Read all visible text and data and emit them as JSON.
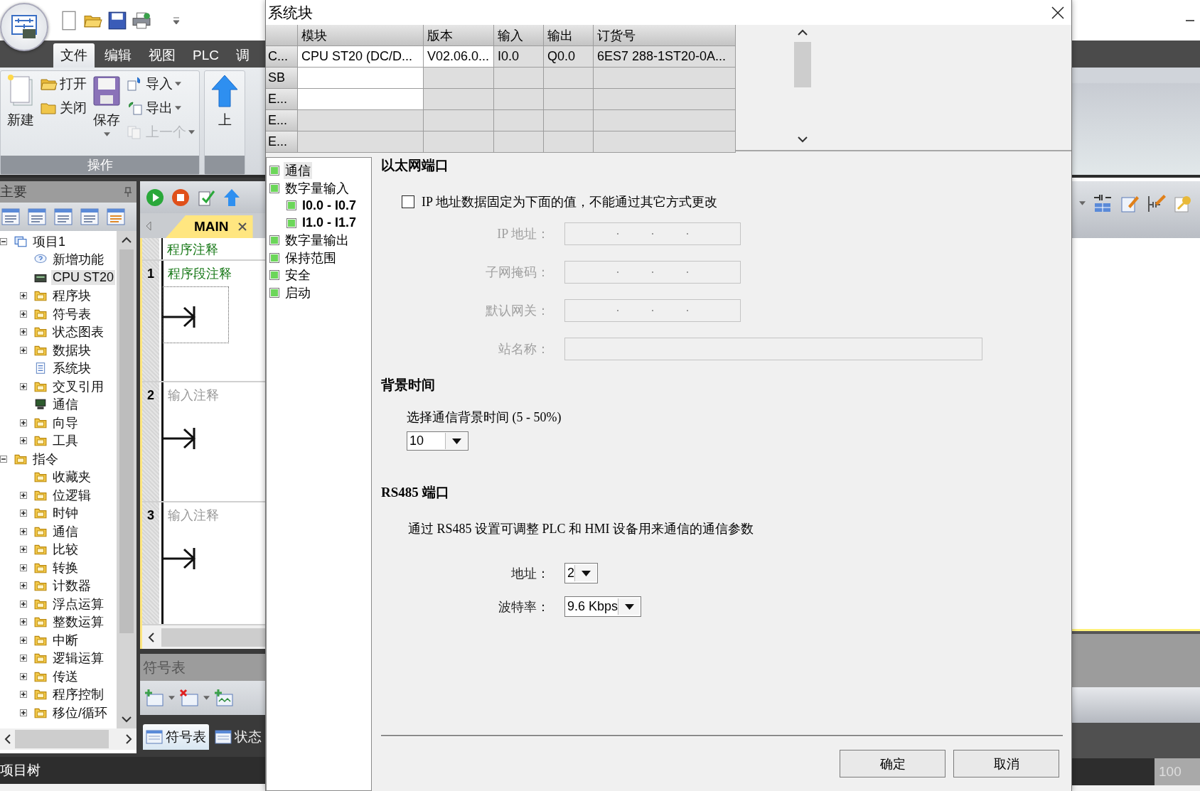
{
  "app": {
    "menu_tabs": [
      {
        "label": "文件",
        "selected": true
      },
      {
        "label": "编辑",
        "selected": false
      },
      {
        "label": "视图",
        "selected": false
      },
      {
        "label": "PLC",
        "selected": false
      },
      {
        "label": "调",
        "selected": false
      }
    ],
    "ribbon_groups": [
      {
        "label": "操作",
        "columns": [
          {
            "buttons": [
              {
                "label": "新建",
                "kind": "new",
                "disabled": false
              }
            ]
          },
          {
            "buttons": [
              {
                "label": "打开",
                "kind": "open",
                "disabled": false
              },
              {
                "label": "关闭",
                "kind": "close",
                "disabled": false
              }
            ]
          },
          {
            "buttons": [
              {
                "label": "保存",
                "kind": "save",
                "disabled": false
              }
            ]
          },
          {
            "buttons": [
              {
                "label": "导入",
                "kind": "import",
                "disabled": false
              },
              {
                "label": "导出",
                "kind": "export",
                "disabled": false
              },
              {
                "label": "上一个",
                "kind": "previous",
                "disabled": true
              }
            ]
          }
        ]
      },
      {
        "columns": [
          {
            "buttons": [
              {
                "label": "上",
                "kind": "upload",
                "disabled": false
              }
            ]
          }
        ]
      }
    ],
    "project_pane": {
      "title": "主要",
      "tree": [
        {
          "label": "项目1",
          "kind": "project",
          "expanded": true,
          "selected": false,
          "children": [
            {
              "label": "新增功能",
              "kind": "help",
              "selected": false
            },
            {
              "label": "CPU ST20",
              "kind": "cpu",
              "selected": true
            },
            {
              "label": "程序块",
              "kind": "folder",
              "expanded": false,
              "selected": false
            },
            {
              "label": "符号表",
              "kind": "folder",
              "expanded": false,
              "selected": false
            },
            {
              "label": "状态图表",
              "kind": "folder",
              "expanded": false,
              "selected": false
            },
            {
              "label": "数据块",
              "kind": "folder",
              "expanded": false,
              "selected": false
            },
            {
              "label": "系统块",
              "kind": "doc",
              "selected": false
            },
            {
              "label": "交叉引用",
              "kind": "folder",
              "expanded": false,
              "selected": false
            },
            {
              "label": "通信",
              "kind": "monitor",
              "selected": false
            },
            {
              "label": "向导",
              "kind": "folder",
              "expanded": false,
              "selected": false
            },
            {
              "label": "工具",
              "kind": "folder",
              "expanded": false,
              "selected": false
            }
          ]
        },
        {
          "label": "指令",
          "kind": "folder",
          "expanded": true,
          "selected": false,
          "children": [
            {
              "label": "收藏夹",
              "kind": "folder",
              "selected": false
            },
            {
              "label": "位逻辑",
              "kind": "folder",
              "expanded": false,
              "selected": false
            },
            {
              "label": "时钟",
              "kind": "folder",
              "expanded": false,
              "selected": false
            },
            {
              "label": "通信",
              "kind": "folder",
              "expanded": false,
              "selected": false
            },
            {
              "label": "比较",
              "kind": "folder",
              "expanded": false,
              "selected": false
            },
            {
              "label": "转换",
              "kind": "folder",
              "expanded": false,
              "selected": false
            },
            {
              "label": "计数器",
              "kind": "folder",
              "expanded": false,
              "selected": false
            },
            {
              "label": "浮点运算",
              "kind": "folder",
              "expanded": false,
              "selected": false
            },
            {
              "label": "整数运算",
              "kind": "folder",
              "expanded": false,
              "selected": false
            },
            {
              "label": "中断",
              "kind": "folder",
              "expanded": false,
              "selected": false
            },
            {
              "label": "逻辑运算",
              "kind": "folder",
              "expanded": false,
              "selected": false
            },
            {
              "label": "传送",
              "kind": "folder",
              "expanded": false,
              "selected": false
            },
            {
              "label": "程序控制",
              "kind": "folder",
              "expanded": false,
              "selected": false
            },
            {
              "label": "移位/循环",
              "kind": "folder",
              "expanded": false,
              "selected": false
            }
          ]
        }
      ]
    },
    "editor": {
      "tab": "MAIN",
      "program_comment": "程序注释",
      "networks": [
        {
          "number": "1",
          "comment": "程序段注释",
          "focused": true
        },
        {
          "number": "2",
          "placeholder": "输入注释",
          "focused": false
        },
        {
          "number": "3",
          "placeholder": "输入注释",
          "focused": false
        }
      ]
    },
    "symbol_pane": {
      "title": "符号表",
      "tabs": [
        {
          "label": "符号表",
          "selected": true
        },
        {
          "label": "状态",
          "selected": false
        }
      ]
    },
    "status_bar": {
      "pane_label": "项目树",
      "zoom": "100"
    }
  },
  "dialog": {
    "title": "系统块",
    "modules_table": {
      "columns": [
        "模块",
        "版本",
        "输入",
        "输出",
        "订货号"
      ],
      "rows": [
        {
          "header": "C...",
          "editable": true,
          "cells": [
            "CPU ST20 (DC/D...",
            "V02.06.0...",
            "I0.0",
            "Q0.0",
            "6ES7 288-1ST20-0A..."
          ]
        },
        {
          "header": "SB",
          "editable": true
        },
        {
          "header": "E...",
          "editable": true
        },
        {
          "header": "E...",
          "editable": false
        },
        {
          "header": "E...",
          "editable": false
        }
      ]
    },
    "nav": [
      {
        "label": "通信",
        "selected": true
      },
      {
        "label": "数字量输入",
        "selected": false,
        "children": [
          {
            "label": "I0.0 - I0.7",
            "selected": false
          },
          {
            "label": "I1.0 - I1.7",
            "selected": false
          }
        ]
      },
      {
        "label": "数字量输出",
        "selected": false
      },
      {
        "label": "保持范围",
        "selected": false
      },
      {
        "label": "安全",
        "selected": false
      },
      {
        "label": "启动",
        "selected": false
      }
    ],
    "ethernet": {
      "heading": "以太网端口",
      "fixed_ip": {
        "label": "IP 地址数据固定为下面的值，不能通过其它方式更改",
        "checked": false
      },
      "fields": [
        {
          "label": "IP 地址：",
          "kind": "ip",
          "disabled": true
        },
        {
          "label": "子网掩码：",
          "kind": "ip",
          "disabled": true
        },
        {
          "label": "默认网关：",
          "kind": "ip",
          "disabled": true
        },
        {
          "label": "站名称：",
          "kind": "text",
          "disabled": true
        }
      ]
    },
    "background_time": {
      "heading": "背景时间",
      "label": "选择通信背景时间 (5 - 50%)",
      "value": "10"
    },
    "rs485": {
      "heading": "RS485 端口",
      "description": "通过 RS485 设置可调整 PLC 和 HMI 设备用来通信的通信参数",
      "fields": [
        {
          "label": "地址：",
          "value": "2"
        },
        {
          "label": "波特率：",
          "value": "9.6 Kbps"
        }
      ]
    },
    "buttons": [
      "确定",
      "取消"
    ]
  }
}
